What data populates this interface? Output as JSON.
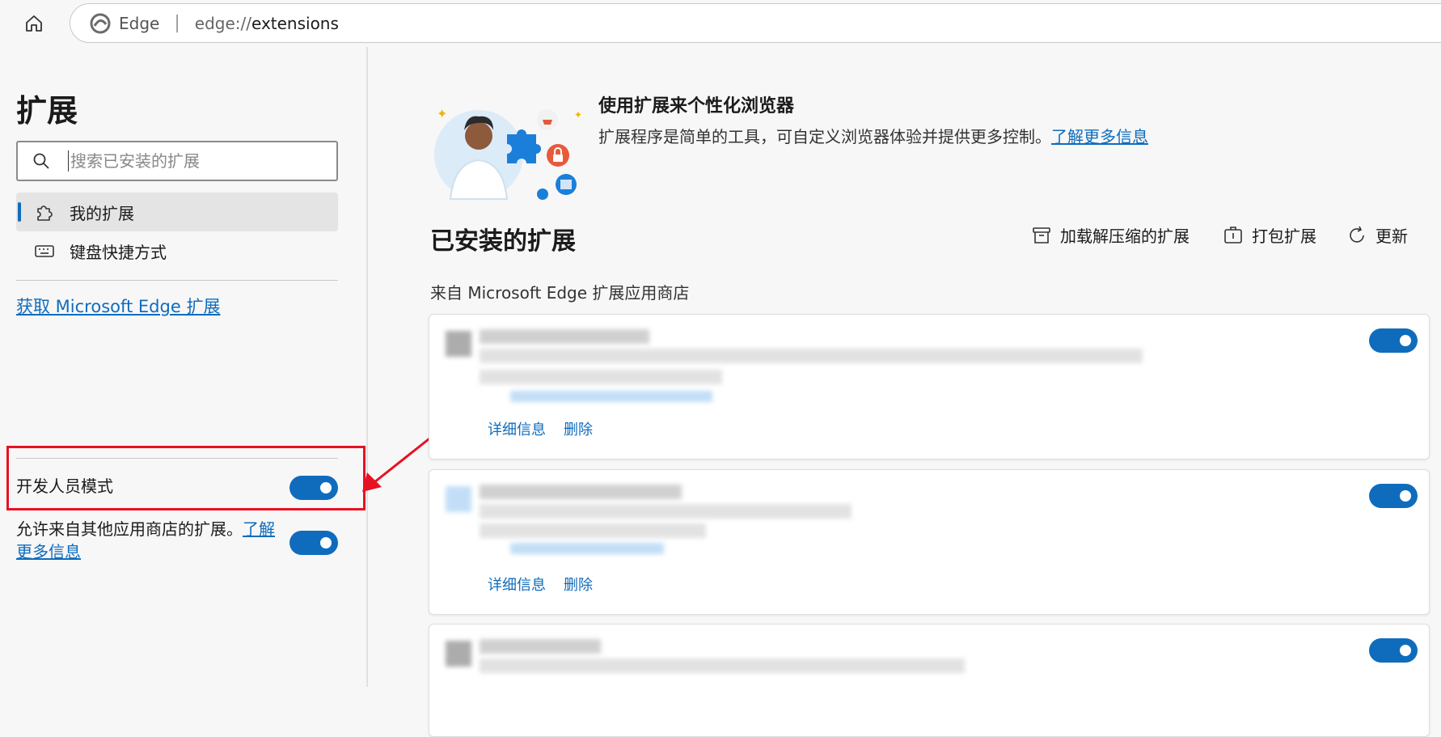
{
  "address_bar": {
    "brand": "Edge",
    "separator": "|",
    "scheme": "edge://",
    "path": "extensions"
  },
  "sidebar": {
    "title": "扩展",
    "search_placeholder": "搜索已安装的扩展",
    "nav": [
      {
        "label": "我的扩展",
        "icon": "puzzle-icon",
        "active": true
      },
      {
        "label": "键盘快捷方式",
        "icon": "keyboard-icon",
        "active": false
      }
    ],
    "get_extensions_link": "获取 Microsoft Edge 扩展",
    "developer_mode_label": "开发人员模式",
    "developer_mode_on": true,
    "allow_other_stores_text": "允许来自其他应用商店的扩展。",
    "allow_other_stores_link": "了解更多信息",
    "allow_other_stores_on": true
  },
  "hero": {
    "title": "使用扩展来个性化浏览器",
    "description": "扩展程序是简单的工具，可自定义浏览器体验并提供更多控制。",
    "link": "了解更多信息"
  },
  "installed": {
    "title": "已安装的扩展",
    "toolbar": {
      "load_unpacked": "加载解压缩的扩展",
      "pack": "打包扩展",
      "update": "更新"
    },
    "source_label": "来自 Microsoft Edge 扩展应用商店",
    "cards": [
      {
        "details": "详细信息",
        "remove": "删除",
        "enabled": true
      },
      {
        "details": "详细信息",
        "remove": "删除",
        "enabled": true
      },
      {
        "enabled": true
      }
    ]
  },
  "colors": {
    "accent": "#0f6cbd",
    "highlight_box": "#e81123"
  }
}
